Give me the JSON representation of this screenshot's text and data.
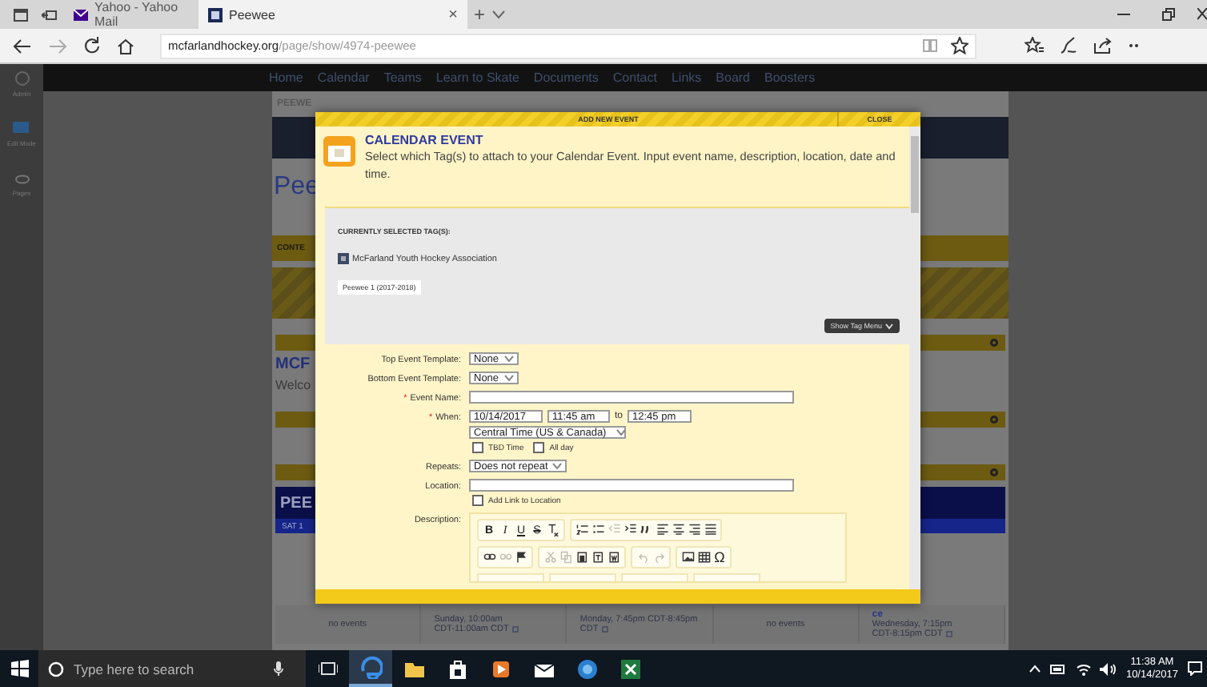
{
  "browser": {
    "tabs": [
      {
        "title": "Yahoo - Yahoo Mail",
        "selected": false
      },
      {
        "title": "Peewee",
        "selected": true,
        "close": "×"
      }
    ],
    "new_tab": "+",
    "address": {
      "host": "mcfarlandhockey.org",
      "path": "/page/show/4974-peewee"
    }
  },
  "site": {
    "sidebar": [
      "Admin",
      "Edit Mode",
      "Pages"
    ],
    "nav": [
      "Home",
      "Calendar",
      "Teams",
      "Learn to Skate",
      "Documents",
      "Contact",
      "Links",
      "Board",
      "Boosters"
    ],
    "breadcrumb": "PEEWE",
    "heading": "Pee",
    "content_tab": "CONTE",
    "section_title": "MCF",
    "section_text": "Welco",
    "team_banner": "PEE",
    "date_bar": "SAT 1",
    "calendar": [
      {
        "kind": "empty",
        "lines": [
          "no events"
        ]
      },
      {
        "kind": "event",
        "lines": [
          "Sunday, 10:00am",
          "CDT-11:00am CDT"
        ]
      },
      {
        "kind": "event",
        "lines": [
          "Monday, 7:45pm CDT-8:45pm",
          "CDT"
        ]
      },
      {
        "kind": "empty",
        "lines": [
          "no events"
        ]
      },
      {
        "kind": "event",
        "title": "ce",
        "lines": [
          "Wednesday, 7:15pm",
          "CDT-8:15pm CDT"
        ]
      }
    ]
  },
  "modal": {
    "header": "ADD NEW EVENT",
    "close": "CLOSE",
    "title": "CALENDAR EVENT",
    "description": "Select which Tag(s) to attach to your Calendar Event. Input event name, description, location, date and time.",
    "tags_heading": "CURRENTLY SELECTED TAG(S):",
    "organization": "McFarland Youth Hockey Association",
    "tags": [
      "Peewee 1 (2017-2018)"
    ],
    "tag_menu_button": "Show Tag Menu",
    "fields": [
      {
        "kind": "select",
        "label": "Top Event Template:",
        "value": "None"
      },
      {
        "kind": "select",
        "label": "Bottom Event Template:",
        "value": "None"
      },
      {
        "kind": "text",
        "label": "Event Name:",
        "required_mark": "*"
      },
      {
        "kind": "when",
        "label": "When:",
        "required_mark": "*",
        "date": "10/14/2017",
        "start": "11:45 am",
        "separator": "to",
        "end": "12:45 pm",
        "timezone": "Central Time (US & Canada)",
        "options": [
          {
            "label": "TBD Time",
            "checked": false
          },
          {
            "label": "All day",
            "checked": false
          }
        ]
      },
      {
        "kind": "select",
        "label": "Repeats:",
        "value": "Does not repeat"
      },
      {
        "kind": "text",
        "label": "Location:",
        "options": [
          {
            "label": "Add Link to Location",
            "checked": false
          }
        ]
      },
      {
        "kind": "editor",
        "label": "Description:",
        "toolbar": [
          [
            [
              {
                "kind": "bold",
                "label": "B",
                "disabled": false
              },
              {
                "kind": "italic",
                "label": "I",
                "disabled": false
              },
              {
                "kind": "underline",
                "label": "U",
                "disabled": false
              },
              {
                "kind": "strike",
                "label": "S",
                "disabled": false
              },
              {
                "kind": "clearformat",
                "disabled": false
              }
            ],
            [
              {
                "kind": "numbered",
                "disabled": false
              },
              {
                "kind": "bulleted",
                "disabled": false
              },
              {
                "kind": "outdent",
                "disabled": true
              },
              {
                "kind": "indent",
                "disabled": false
              },
              {
                "kind": "quote",
                "disabled": false
              },
              {
                "kind": "alignleft",
                "disabled": false
              },
              {
                "kind": "aligncenter",
                "disabled": false
              },
              {
                "kind": "alignright",
                "disabled": false
              },
              {
                "kind": "justify",
                "disabled": false
              }
            ]
          ],
          [
            [
              {
                "kind": "link",
                "disabled": false
              },
              {
                "kind": "unlink",
                "disabled": true
              },
              {
                "kind": "anchor",
                "disabled": false
              }
            ],
            [
              {
                "kind": "cut",
                "disabled": true
              },
              {
                "kind": "copy",
                "disabled": true
              },
              {
                "kind": "paste",
                "disabled": false
              },
              {
                "kind": "pastetext",
                "disabled": false
              },
              {
                "kind": "pasteword",
                "disabled": false
              }
            ],
            [
              {
                "kind": "undo",
                "disabled": true
              },
              {
                "kind": "redo",
                "disabled": true
              }
            ],
            [
              {
                "kind": "image",
                "disabled": false
              },
              {
                "kind": "table",
                "disabled": false
              },
              {
                "kind": "special",
                "label": "Ω",
                "disabled": false
              }
            ]
          ]
        ]
      }
    ]
  },
  "taskbar": {
    "search_placeholder": "Type here to search",
    "apps": [
      {
        "kind": "edge",
        "active": true
      },
      {
        "kind": "folder",
        "active": false
      },
      {
        "kind": "store",
        "active": false
      },
      {
        "kind": "media",
        "active": false
      },
      {
        "kind": "mail",
        "active": false
      },
      {
        "kind": "globe",
        "active": false
      },
      {
        "kind": "excel",
        "active": false
      }
    ],
    "time": "11:38 AM",
    "date": "10/14/2017"
  }
}
